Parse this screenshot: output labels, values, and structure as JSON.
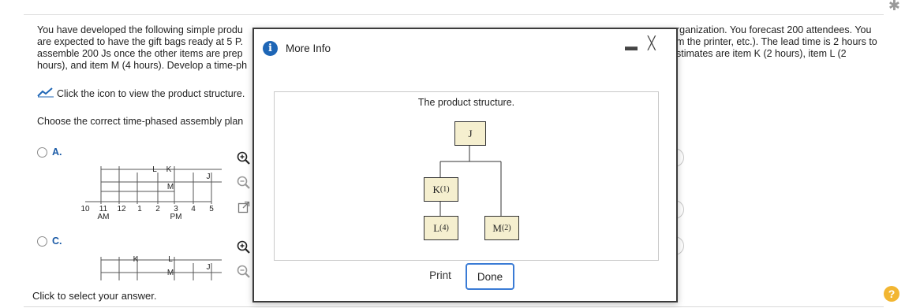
{
  "question": {
    "left_lines": [
      "You have developed the following simple produ",
      "are expected to have the gift bags ready at 5 P.",
      "assemble 200 Js once the other items are prep",
      "hours), and item M (4 hours). Develop a time-ph"
    ],
    "right_lines": [
      "rganization. You forecast 200 attendees. You",
      "m the printer, etc.). The lead time is 2 hours to",
      "stimates are item K (2 hours), item L (2"
    ],
    "view_link": "Click the icon to view the product structure.",
    "prompt": "Choose the correct time-phased assembly plan"
  },
  "options": [
    {
      "label": "A.",
      "bars": [
        "L",
        "K",
        "M",
        "J"
      ],
      "ticks": [
        "10",
        "11",
        "12",
        "1",
        "2",
        "3",
        "4",
        "5"
      ],
      "am": "AM",
      "pm": "PM"
    },
    {
      "label": "C.",
      "bars": [
        "K",
        "L",
        "M",
        "J"
      ]
    }
  ],
  "footer": "Click to select your answer.",
  "help_icon": "?",
  "modal": {
    "title": "More Info",
    "info_icon": "i",
    "minimize": "▬",
    "close": "╳",
    "structure_title": "The product structure.",
    "nodes": {
      "root": "J",
      "k": "K",
      "k_qty": "(1)",
      "l": "L",
      "l_qty": "(4)",
      "m": "M",
      "m_qty": "(2)"
    },
    "print_label": "Print",
    "done_label": "Done"
  },
  "colors": {
    "accent": "#1e66b6",
    "done_border": "#3a7bd5",
    "node_fill": "#f5efcf",
    "help": "#f2b632"
  }
}
